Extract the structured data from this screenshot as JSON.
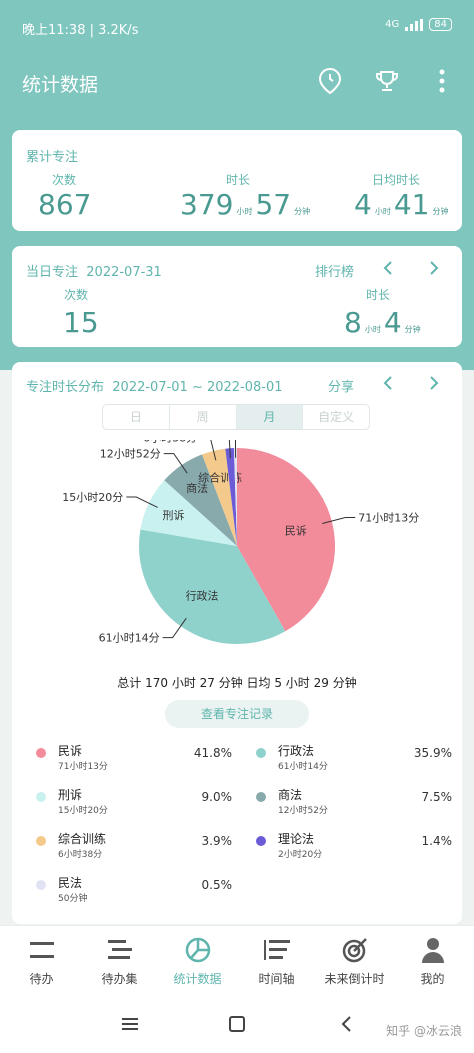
{
  "status": {
    "time": "晚上11:38 | 3.2K/s",
    "battery": "84",
    "net": "4G"
  },
  "appbar": {
    "title": "统计数据"
  },
  "total_card": {
    "title": "累计专注",
    "count_label": "次数",
    "count": "867",
    "duration_label": "时长",
    "dur_h": "379",
    "unit_h": "小时",
    "dur_m": "57",
    "unit_m": "分钟",
    "avg_label": "日均时长",
    "avg_h": "4",
    "avg_m": "41"
  },
  "day_card": {
    "title": "当日专注",
    "date": "2022-07-31",
    "rank": "排行榜",
    "count_label": "次数",
    "count": "15",
    "duration_label": "时长",
    "dur_h": "8",
    "dur_m": "4",
    "unit_h": "小时",
    "unit_m": "分钟"
  },
  "dist_card": {
    "title": "专注时长分布",
    "range": "2022-07-01 ~ 2022-08-01",
    "share": "分享",
    "tabs": [
      "日",
      "周",
      "月",
      "自定义"
    ],
    "total_text": "总计 170 小时 27 分钟 日均 5 小时 29 分钟",
    "record_button": "查看专注记录"
  },
  "chart_data": {
    "type": "pie",
    "series": [
      {
        "name": "民诉",
        "time": "71小时13分",
        "value": 41.8,
        "pct": "41.8%",
        "color": "#f28b9a"
      },
      {
        "name": "行政法",
        "time": "61小时14分",
        "value": 35.9,
        "pct": "35.9%",
        "color": "#8fd1cb"
      },
      {
        "name": "刑诉",
        "time": "15小时20分",
        "value": 9.0,
        "pct": "9.0%",
        "color": "#c9f1ef"
      },
      {
        "name": "商法",
        "time": "12小时52分",
        "value": 7.5,
        "pct": "7.5%",
        "color": "#88aaad"
      },
      {
        "name": "综合训练",
        "time": "6小时38分",
        "value": 3.9,
        "pct": "3.9%",
        "color": "#f4c98c"
      },
      {
        "name": "理论法",
        "time": "2小时20分",
        "value": 1.4,
        "pct": "1.4%",
        "color": "#6c5bd6"
      },
      {
        "name": "民法",
        "time": "50分钟",
        "value": 0.5,
        "pct": "0.5%",
        "color": "#e1e3f3"
      }
    ]
  },
  "nav": [
    {
      "label": "待办",
      "icon": "menu-icon"
    },
    {
      "label": "待办集",
      "icon": "list-icon"
    },
    {
      "label": "统计数据",
      "icon": "pie-chart-icon"
    },
    {
      "label": "时间轴",
      "icon": "timeline-icon"
    },
    {
      "label": "未来倒计时",
      "icon": "target-icon"
    },
    {
      "label": "我的",
      "icon": "person-icon"
    }
  ],
  "watermark": "知乎 @冰云浪"
}
